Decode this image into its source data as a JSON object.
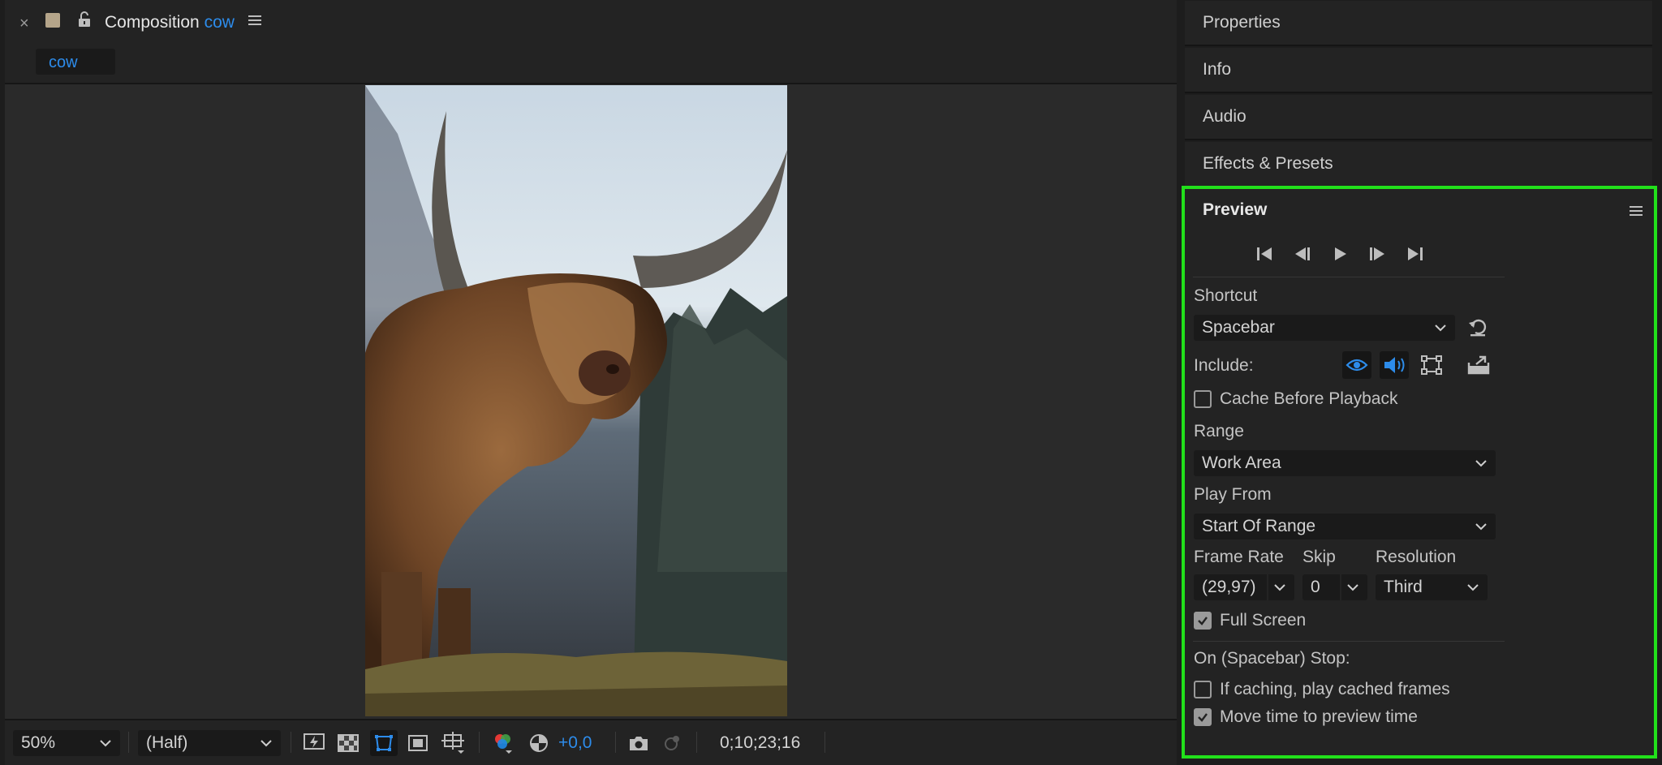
{
  "composition": {
    "title_prefix": "Composition",
    "title_name": "cow",
    "subtab": "cow"
  },
  "viewer": {
    "image_alt": "Highland cow with long horns in a meadow"
  },
  "toolbar": {
    "zoom": "50%",
    "resolution": "(Half)",
    "exposure": "+0,0",
    "timecode": "0;10;23;16"
  },
  "panels": {
    "properties": "Properties",
    "info": "Info",
    "audio": "Audio",
    "effects": "Effects & Presets"
  },
  "preview": {
    "title": "Preview",
    "shortcut_label": "Shortcut",
    "shortcut_value": "Spacebar",
    "include_label": "Include:",
    "cache_before_playback": "Cache Before Playback",
    "range_label": "Range",
    "range_value": "Work Area",
    "play_from_label": "Play From",
    "play_from_value": "Start Of Range",
    "frame_rate_label": "Frame Rate",
    "skip_label": "Skip",
    "resolution_label": "Resolution",
    "frame_rate_value": "(29,97)",
    "skip_value": "0",
    "resolution_value": "Third",
    "full_screen": "Full Screen",
    "stop_label": "On (Spacebar) Stop:",
    "if_caching": "If caching, play cached frames",
    "move_time": "Move time to preview time",
    "checks": {
      "cache_before_playback": false,
      "full_screen": true,
      "if_caching": false,
      "move_time": true
    }
  },
  "colors": {
    "accent": "#2d8ceb",
    "highlight_border": "#22e01b"
  }
}
